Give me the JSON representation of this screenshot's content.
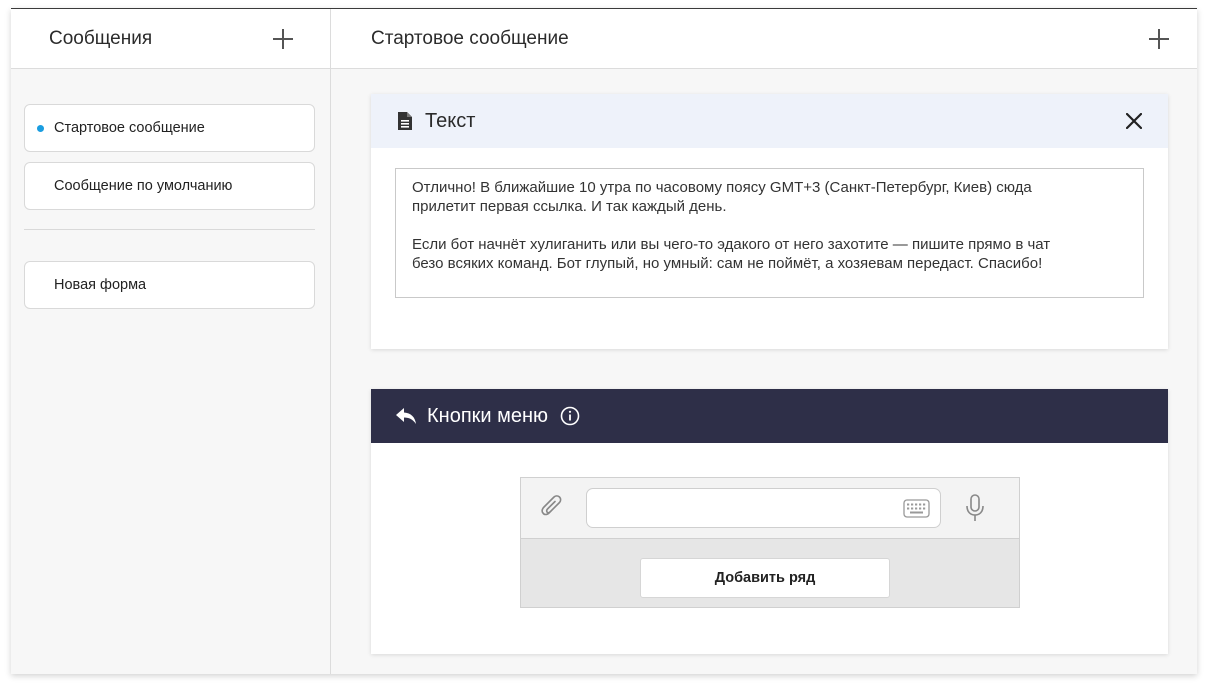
{
  "sidebar": {
    "title": "Сообщения",
    "items": [
      {
        "label": "Стартовое сообщение",
        "active": true
      },
      {
        "label": "Сообщение по умолчанию",
        "active": false
      }
    ],
    "forms": [
      {
        "label": "Новая форма"
      }
    ]
  },
  "main": {
    "title": "Стартовое сообщение",
    "text_block": {
      "title": "Текст",
      "icon": "document-icon",
      "content": "Отлично! В ближайшие 10 утра по часовому поясу GMT+3 (Санкт-Петербург, Киев) сюда\nприлетит первая ссылка. И так каждый день.\n\nЕсли бот начнёт хулиганить или вы чего-то эдакого от него захотите — пишите прямо в чат\nбезо всяких команд. Бот глупый, но умный: сам не поймёт, а хозяевам передаст. Спасибо!"
    },
    "menu_block": {
      "title": "Кнопки меню",
      "icon": "reply-icon",
      "add_row_label": "Добавить ряд"
    }
  },
  "colors": {
    "accent": "#1a9de0",
    "menu_header": "#2e2f48",
    "text_header": "#eef2fa"
  }
}
